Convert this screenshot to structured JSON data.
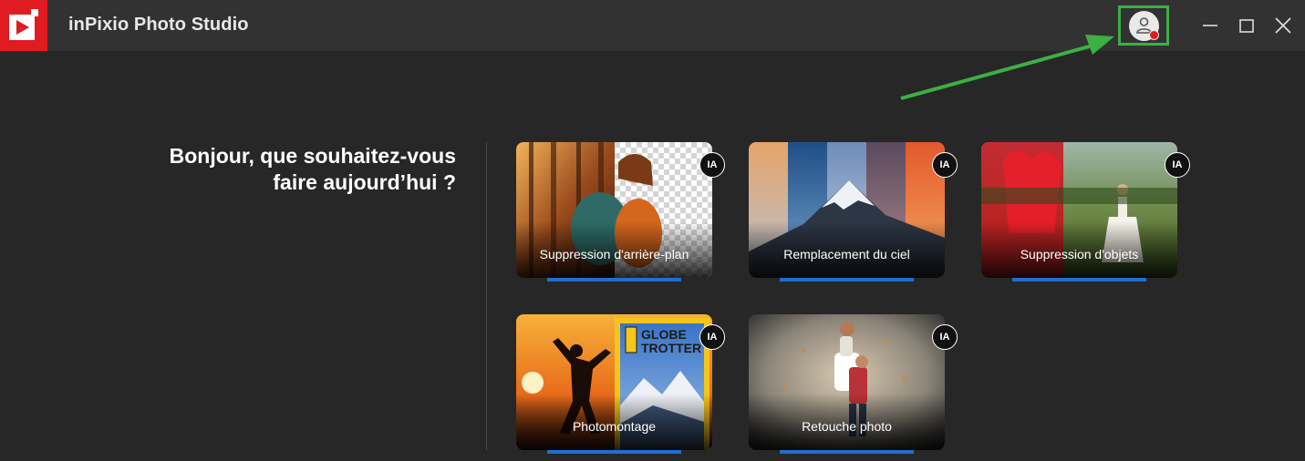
{
  "app": {
    "title": "inPixio Photo Studio"
  },
  "header": {
    "user_icon": "user-icon",
    "notification_color": "#e01b22",
    "highlight_color": "#3cb043"
  },
  "window_controls": [
    "minimize-icon",
    "maximize-icon",
    "close-icon"
  ],
  "greeting": {
    "line1": "Bonjour, que souhaitez-vous",
    "line2": "faire aujourd’hui ?"
  },
  "badge_text": "IA",
  "accent_color": "#1f6fd1",
  "cards": [
    {
      "label": "Suppression d'arrière-plan"
    },
    {
      "label": "Remplacement du ciel"
    },
    {
      "label": "Suppression d'objets"
    },
    {
      "label": "Photomontage"
    },
    {
      "label": "Retouche photo"
    }
  ],
  "magazine": {
    "title_line1": "GLOBE",
    "title_line2": "TROTTER"
  }
}
